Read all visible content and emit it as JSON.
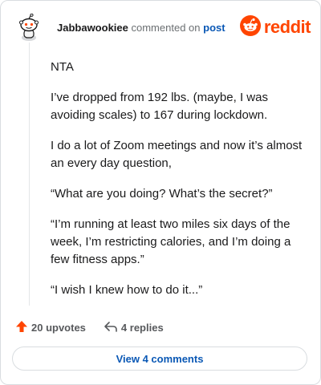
{
  "header": {
    "username": "Jabbawookiee",
    "action_text": "commented on",
    "post_link": "post",
    "brand_name": "reddit",
    "brand_color": "#ff4500",
    "avatar_icon": "snoo-avatar-icon",
    "logo_icon": "reddit-alien-logo-icon"
  },
  "comment": {
    "paragraphs": [
      "NTA",
      "I’ve dropped from 192 lbs. (maybe, I was avoiding scales) to 167 during lockdown.",
      "I do a lot of Zoom meetings and now it’s almost an every day question,",
      "“What are you doing? What’s the secret?”",
      "“I’m running at least two miles six days of the week, I’m restricting calories, and I’m doing a few fitness apps.”",
      "“I wish I knew how to do it...”"
    ]
  },
  "actions": {
    "upvotes_label": "20 upvotes",
    "upvote_icon": "upvote-arrow-icon",
    "replies_label": "4 replies",
    "reply_icon": "reply-arrow-icon"
  },
  "footer": {
    "view_comments_label": "View 4 comments"
  }
}
